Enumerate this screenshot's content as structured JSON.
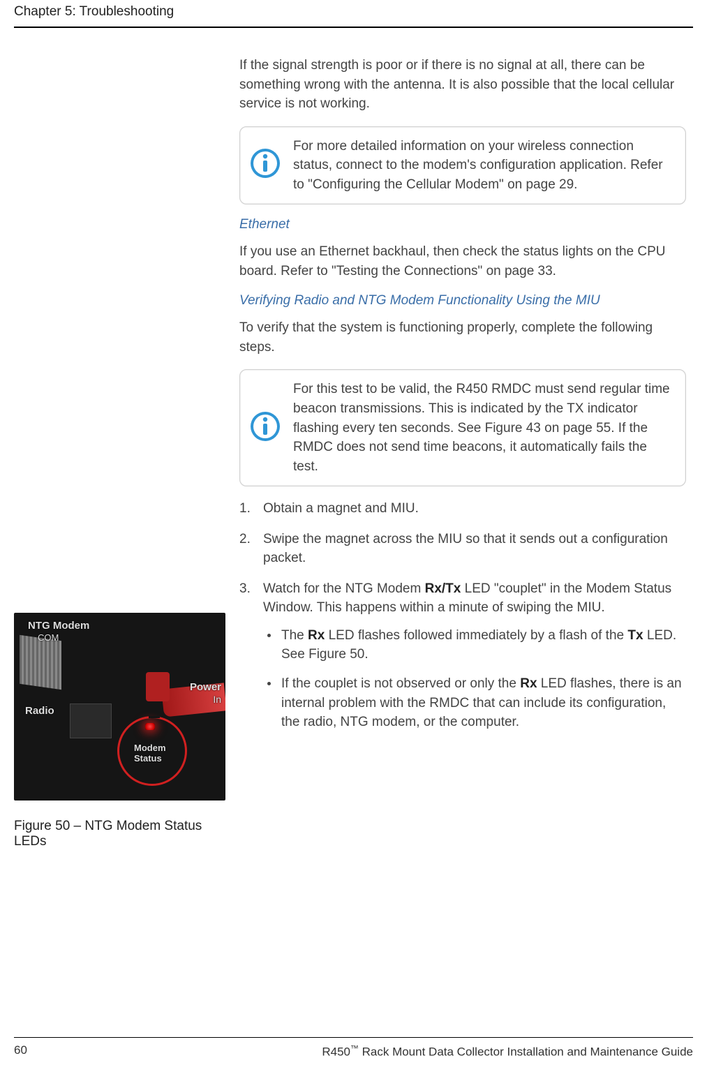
{
  "header": {
    "chapter": "Chapter 5: Troubleshooting"
  },
  "intro": {
    "p1": "If the signal strength is poor or if there is no signal at all, there can be something wrong with the antenna. It is also possible that the local cellular service is not working."
  },
  "note1": {
    "text": "For more detailed information on your wireless connection status, connect to the modem's configuration application. Refer to \"Configuring the Cellular Modem\" on page 29."
  },
  "ethernet": {
    "heading": "Ethernet",
    "p": "If you use an Ethernet backhaul, then check the status lights on the CPU board. Refer to \"Testing the Connections\" on page 33."
  },
  "verify": {
    "heading": "Verifying Radio and NTG Modem Functionality Using the MIU",
    "p": "To verify that the system is functioning properly, complete the following steps."
  },
  "note2": {
    "text": "For this test to be valid, the R450 RMDC must send regular time beacon transmissions. This is indicated by the TX indicator flashing every ten seconds. See Figure 43 on page 55. If the RMDC does not send time beacons, it automatically fails the test."
  },
  "steps": {
    "s1": "Obtain a magnet and MIU.",
    "s2": "Swipe the magnet across the MIU so that it sends out a configuration packet.",
    "s3_pre": "Watch for the NTG Modem ",
    "s3_rxtx": "Rx/Tx",
    "s3_post": " LED \"couplet\" in the Modem Status Window. This happens within a minute of swiping the MIU.",
    "s3_b1_pre": "The ",
    "s3_b1_rx": "Rx",
    "s3_b1_mid": " LED flashes followed immediately by a flash of the ",
    "s3_b1_tx": "Tx",
    "s3_b1_post": " LED. See Figure 50.",
    "s3_b2_pre": "If the couplet is not observed or only the ",
    "s3_b2_rx": "Rx",
    "s3_b2_post": " LED flashes, there is an internal problem with the RMDC that can include its configuration, the radio, NTG modem, or the computer."
  },
  "figure": {
    "labels": {
      "ntg": "NTG Modem",
      "com": "COM",
      "power": "Power",
      "in": "In",
      "radio": "Radio",
      "modem": "Modem",
      "status": "Status"
    },
    "caption_pre": "Figure 50  –  ",
    "caption": "NTG Modem Status LEDs"
  },
  "footer": {
    "page": "60",
    "doc_pre": "R450",
    "tm": "™",
    "doc_post": " Rack Mount Data Collector Installation and Maintenance Guide"
  }
}
